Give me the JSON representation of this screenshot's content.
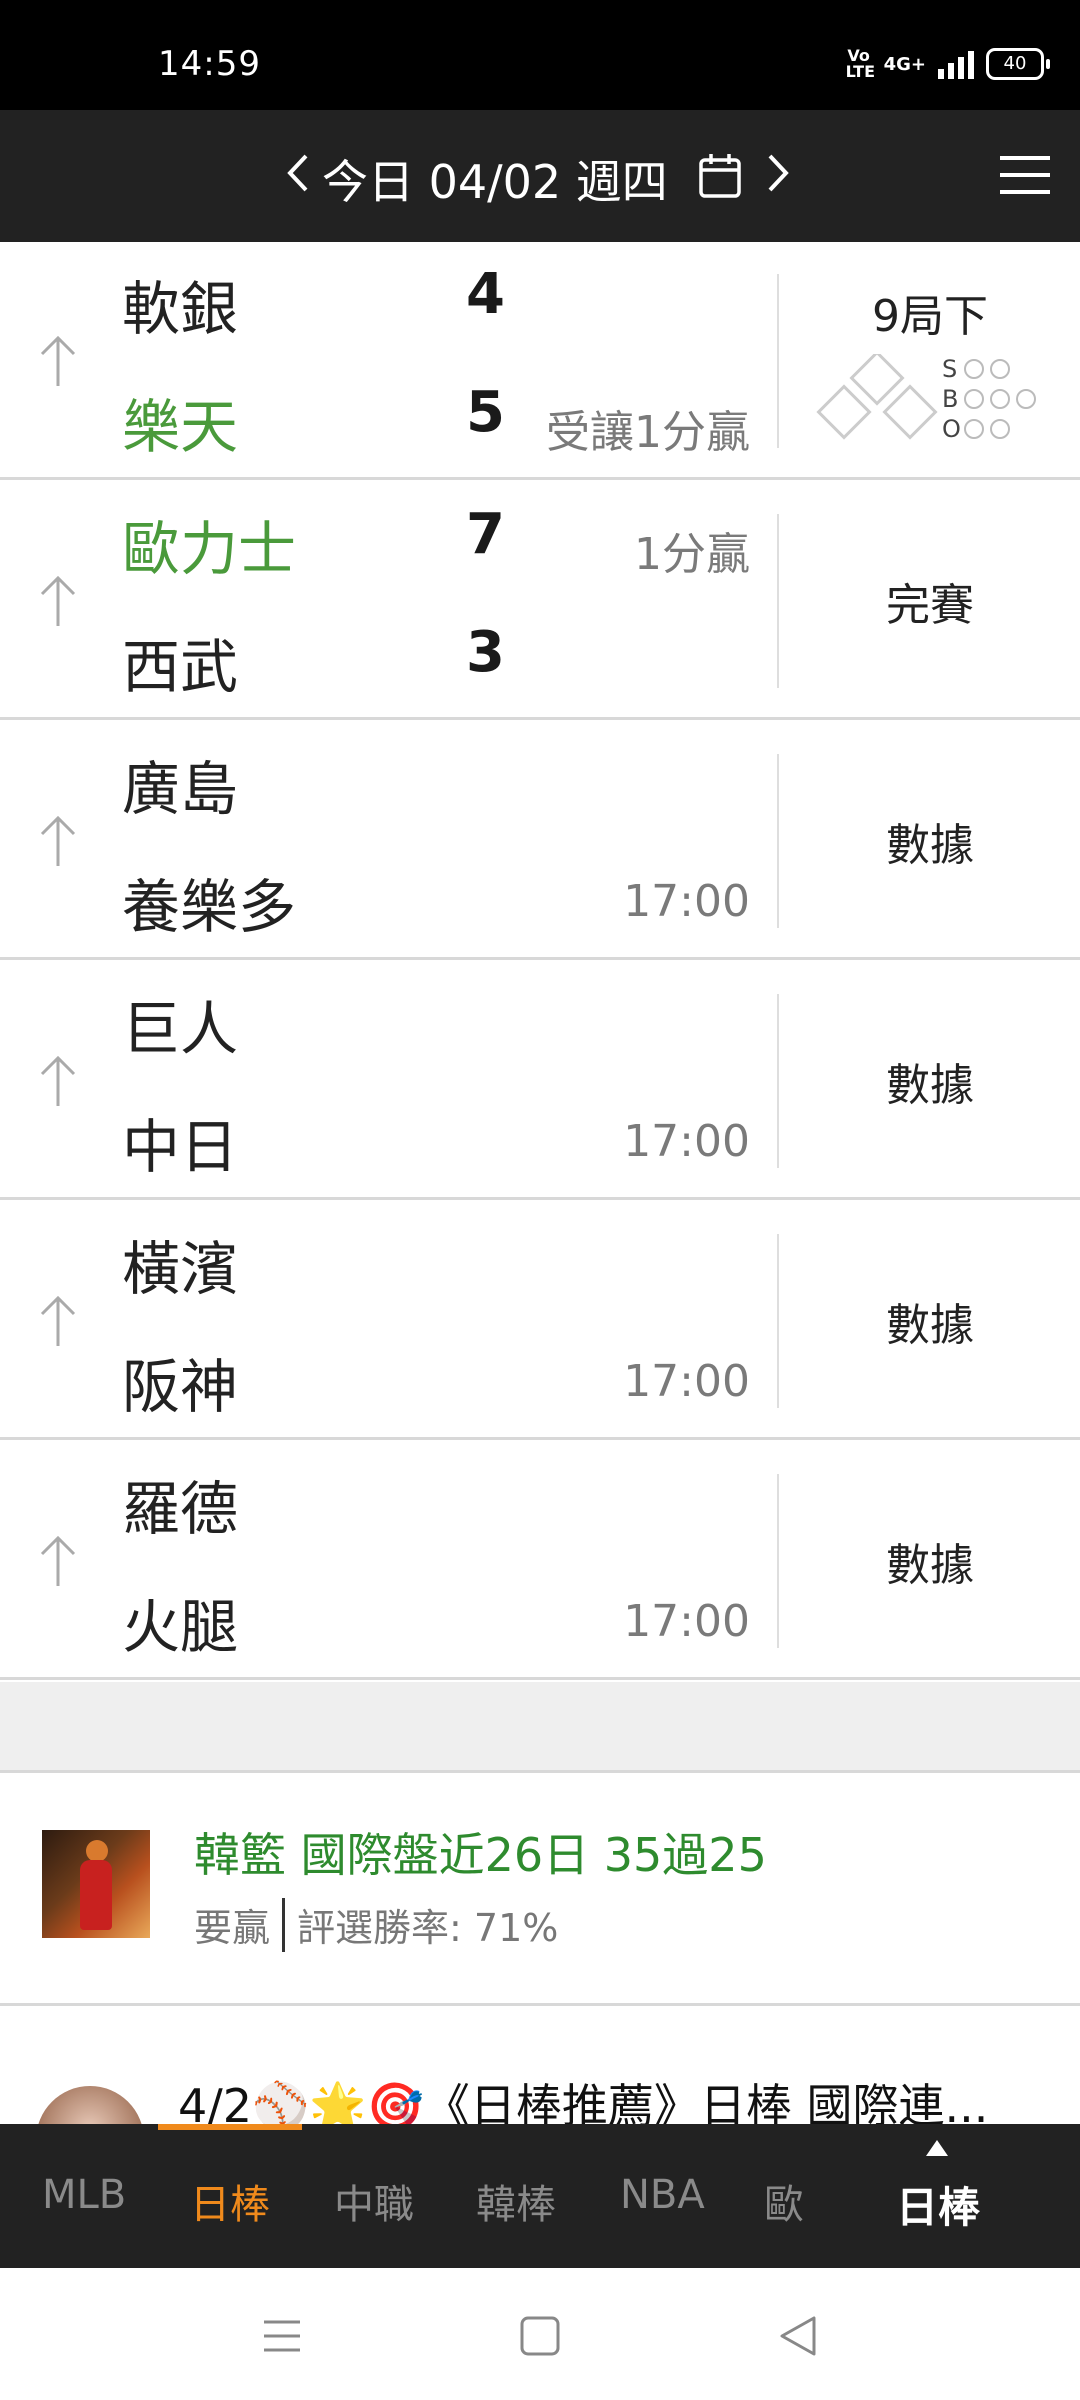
{
  "status_bar": {
    "time": "14:59",
    "volte": "Vo\nLTE",
    "network": "4G+",
    "battery": "40"
  },
  "header": {
    "date_title": "今日 04/02 週四",
    "prev_icon": "chevron-left-icon",
    "next_icon": "chevron-right-icon",
    "calendar_icon": "calendar-icon",
    "menu_icon": "hamburger-menu-icon"
  },
  "games": [
    {
      "team_a": "軟銀",
      "team_b": "樂天",
      "score_a": "4",
      "score_b": "5",
      "note_a": "",
      "note_b": "受讓1分贏",
      "winner": "b",
      "status": "9局下"
    },
    {
      "team_a": "歐力士",
      "team_b": "西武",
      "score_a": "7",
      "score_b": "3",
      "note_a": "1分贏",
      "note_b": "",
      "winner": "a",
      "status": "完賽"
    },
    {
      "team_a": "廣島",
      "team_b": "養樂多",
      "score_a": "",
      "score_b": "",
      "note_a": "",
      "note_b": "17:00",
      "winner": "",
      "status": "數據"
    },
    {
      "team_a": "巨人",
      "team_b": "中日",
      "score_a": "",
      "score_b": "",
      "note_a": "",
      "note_b": "17:00",
      "winner": "",
      "status": "數據"
    },
    {
      "team_a": "橫濱",
      "team_b": "阪神",
      "score_a": "",
      "score_b": "",
      "note_a": "",
      "note_b": "17:00",
      "winner": "",
      "status": "數據"
    },
    {
      "team_a": "羅德",
      "team_b": "火腿",
      "score_a": "",
      "score_b": "",
      "note_a": "",
      "note_b": "17:00",
      "winner": "",
      "status": "數據"
    }
  ],
  "live_indicator": {
    "labels": [
      "S",
      "B",
      "O"
    ],
    "colors": {
      "dot_empty": "#bbbbbb",
      "base_empty": "#cccccc"
    }
  },
  "articles": [
    {
      "title": "韓籃 國際盤近26日 35過25",
      "tag": "要贏",
      "stat": "評選勝率: 71%"
    },
    {
      "title": "4/2⚾🌟🎯《日棒推薦》日棒 國際連..."
    }
  ],
  "tabs": [
    {
      "label": "MLB",
      "active": false
    },
    {
      "label": "日棒",
      "active": true
    },
    {
      "label": "中職",
      "active": false
    },
    {
      "label": "韓棒",
      "active": false
    },
    {
      "label": "NBA",
      "active": false
    },
    {
      "label": "歐",
      "active": false
    }
  ],
  "current_league": "日棒",
  "colors": {
    "header_bg": "#222222",
    "winner_green": "#4a9a3b",
    "accent_orange": "#f08a1c",
    "article_green": "#2e8b2e"
  },
  "system_nav": {
    "menu_icon": "recent-apps-icon",
    "home_icon": "home-icon",
    "back_icon": "back-icon"
  }
}
